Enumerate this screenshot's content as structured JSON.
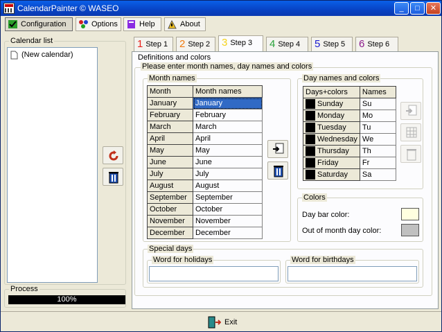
{
  "window": {
    "title": "CalendarPainter © WASEO",
    "minimize": "_",
    "maximize": "□",
    "close": "✕"
  },
  "toolbar": {
    "configuration": "Configuration",
    "options": "Options",
    "help": "Help",
    "about": "About"
  },
  "sidebar": {
    "calendar_list_label": "Calendar list",
    "items": [
      "(New calendar)"
    ],
    "process_label": "Process",
    "progress_text": "100%",
    "progress_value": 1.0
  },
  "tabs": [
    {
      "num": "1",
      "label": "Step 1",
      "color": "#e8201b"
    },
    {
      "num": "2",
      "label": "Step 2",
      "color": "#f07a0d"
    },
    {
      "num": "3",
      "label": "Step 3",
      "color": "#f5d21a"
    },
    {
      "num": "4",
      "label": "Step 4",
      "color": "#2aa33a"
    },
    {
      "num": "5",
      "label": "Step 5",
      "color": "#1a1ad0"
    },
    {
      "num": "6",
      "label": "Step 6",
      "color": "#8b1a8b"
    }
  ],
  "active_tab": "Step 3",
  "definitions": {
    "group_label": "Definitions and colors",
    "instruction": "Please enter month names, day names and colors",
    "month_group_label": "Month names",
    "month_headers": [
      "Month",
      "Month names"
    ],
    "months": [
      {
        "month": "January",
        "name": "January"
      },
      {
        "month": "February",
        "name": "February"
      },
      {
        "month": "March",
        "name": "March"
      },
      {
        "month": "April",
        "name": "April"
      },
      {
        "month": "May",
        "name": "May"
      },
      {
        "month": "June",
        "name": "June"
      },
      {
        "month": "July",
        "name": "July"
      },
      {
        "month": "August",
        "name": "August"
      },
      {
        "month": "September",
        "name": "September"
      },
      {
        "month": "October",
        "name": "October"
      },
      {
        "month": "November",
        "name": "November"
      },
      {
        "month": "December",
        "name": "December"
      }
    ],
    "day_group_label": "Day names and colors",
    "day_headers": [
      "Days+colors",
      "Names"
    ],
    "days": [
      {
        "day": "Sunday",
        "name": "Su"
      },
      {
        "day": "Monday",
        "name": "Mo"
      },
      {
        "day": "Tuesday",
        "name": "Tu"
      },
      {
        "day": "Wednesday",
        "name": "We"
      },
      {
        "day": "Thursday",
        "name": "Th"
      },
      {
        "day": "Friday",
        "name": "Fr"
      },
      {
        "day": "Saturday",
        "name": "Sa"
      }
    ],
    "day_swatch_color": "#000000",
    "colors_group_label": "Colors",
    "day_bar_label": "Day bar color:",
    "day_bar_color": "#ffffe0",
    "out_of_month_label": "Out of month day color:",
    "out_of_month_color": "#c0c0c0",
    "special_days_label": "Special days",
    "holidays_label": "Word for holidays",
    "holidays_value": "",
    "birthdays_label": "Word for birthdays",
    "birthdays_value": ""
  },
  "footer": {
    "exit_label": "Exit"
  },
  "colors": {
    "selection": "#316ac5",
    "titlebar": "#0a4fd8"
  }
}
